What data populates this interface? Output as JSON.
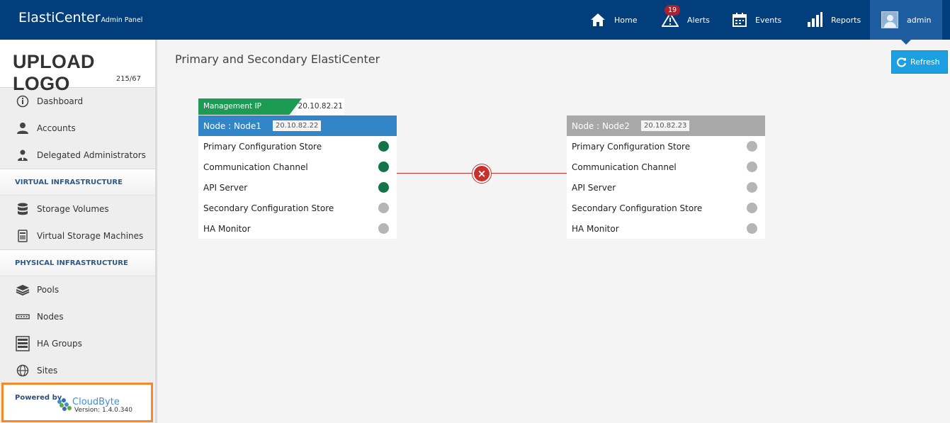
{
  "app": {
    "title": "ElastiCenter",
    "subtitle": "Admin Panel"
  },
  "nav": {
    "home": "Home",
    "alerts": "Alerts",
    "alerts_count": "19",
    "events": "Events",
    "reports": "Reports",
    "user": "admin"
  },
  "sidebar": {
    "logo_text": "UPLOAD LOGO",
    "logo_size": "215/67",
    "items": [
      {
        "label": "Dashboard",
        "icon": "info-icon"
      },
      {
        "label": "Accounts",
        "icon": "user-icon"
      },
      {
        "label": "Delegated Administrators",
        "icon": "admin-icon"
      }
    ],
    "section_virtual": "VIRTUAL INFRASTRUCTURE",
    "virtual_items": [
      {
        "label": "Storage Volumes",
        "icon": "database-icon"
      },
      {
        "label": "Virtual Storage Machines",
        "icon": "server-icon"
      }
    ],
    "section_physical": "PHYSICAL INFRASTRUCTURE",
    "physical_items": [
      {
        "label": "Pools",
        "icon": "layers-icon"
      },
      {
        "label": "Nodes",
        "icon": "node-icon"
      },
      {
        "label": "HA Groups",
        "icon": "rack-icon"
      },
      {
        "label": "Sites",
        "icon": "globe-icon"
      }
    ],
    "powered_by": "Powered by",
    "brand": "CloudByte",
    "version": "Version: 1.4.0.340"
  },
  "main": {
    "title": "Primary and Secondary ElastiCenter",
    "refresh_label": "Refresh",
    "management_label": "Management IP",
    "management_ip": "20.10.82.21",
    "nodes": [
      {
        "header": "Node : Node1",
        "ip": "20.10.82.22",
        "rows": [
          {
            "label": "Primary Configuration Store",
            "status": "green"
          },
          {
            "label": "Communication Channel",
            "status": "green"
          },
          {
            "label": "API Server",
            "status": "green"
          },
          {
            "label": "Secondary Configuration Store",
            "status": "gray"
          },
          {
            "label": "HA Monitor",
            "status": "gray"
          }
        ]
      },
      {
        "header": "Node : Node2",
        "ip": "20.10.82.23",
        "rows": [
          {
            "label": "Primary Configuration Store",
            "status": "gray"
          },
          {
            "label": "Communication Channel",
            "status": "gray"
          },
          {
            "label": "API Server",
            "status": "gray"
          },
          {
            "label": "Secondary Configuration Store",
            "status": "gray"
          },
          {
            "label": "HA Monitor",
            "status": "gray"
          }
        ]
      }
    ],
    "link_status": "×"
  },
  "colors": {
    "topbar": "#033e7c",
    "status_green": "#137547",
    "status_gray": "#b5b5b5",
    "link_error": "#c8302e",
    "refresh": "#1da0e2"
  }
}
